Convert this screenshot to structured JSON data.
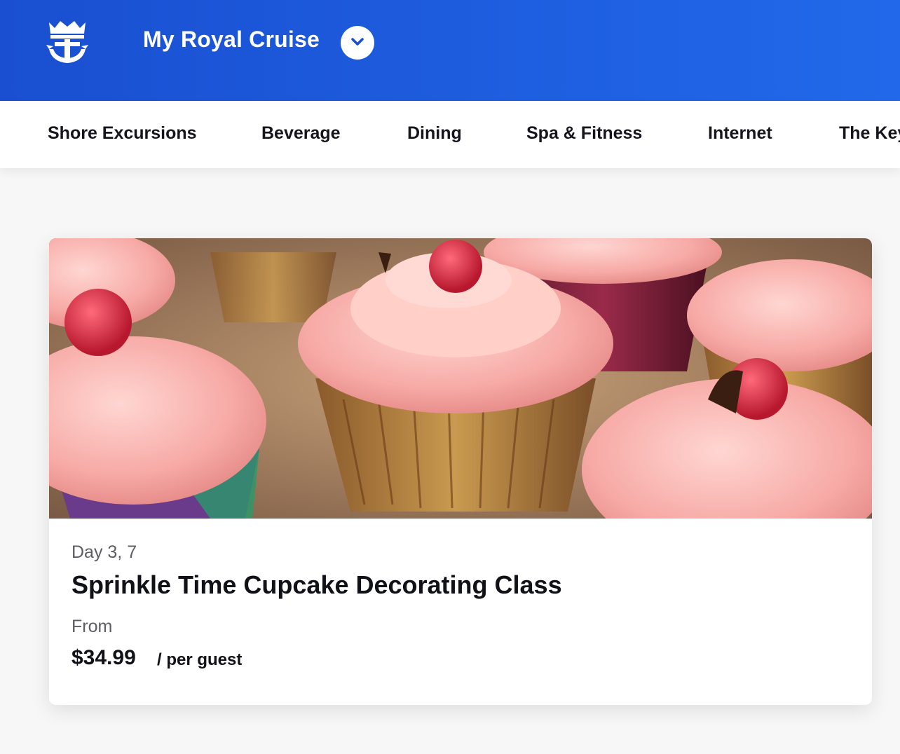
{
  "header": {
    "title": "My Royal Cruise",
    "logo_icon": "crown-anchor-logo-icon",
    "dropdown_icon": "chevron-down-icon",
    "background_start": "#1a4fd1",
    "background_end": "#2169ea"
  },
  "nav": {
    "items": [
      {
        "label": "Shore Excursions"
      },
      {
        "label": "Beverage"
      },
      {
        "label": "Dining"
      },
      {
        "label": "Spa & Fitness"
      },
      {
        "label": "Internet"
      },
      {
        "label": "The Key"
      }
    ]
  },
  "card": {
    "image_alt": "cupcakes with pink frosting and raspberries",
    "day": "Day 3, 7",
    "title": "Sprinkle Time Cupcake Decorating Class",
    "from_label": "From",
    "price": "$34.99",
    "price_unit": "/ per guest"
  }
}
